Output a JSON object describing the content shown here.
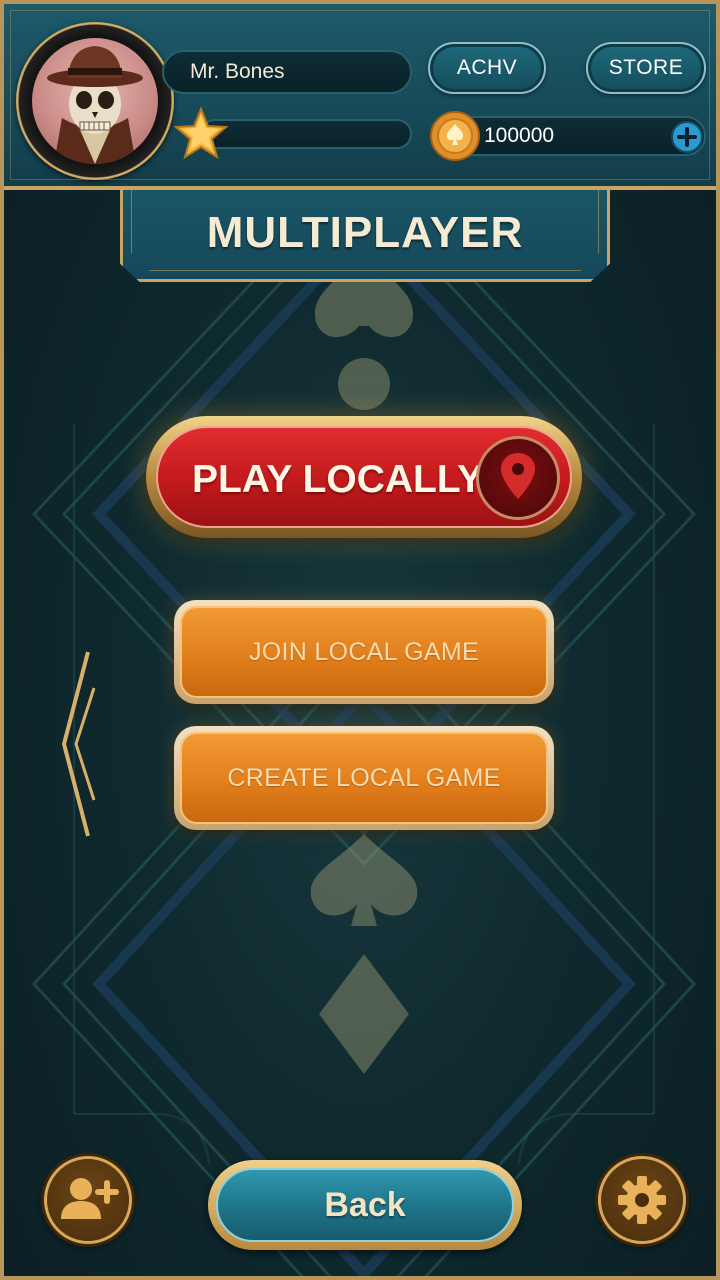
{
  "profile": {
    "player_name": "Mr. Bones",
    "coins": "100000"
  },
  "header": {
    "achievements_label": "ACHV",
    "store_label": "STORE"
  },
  "screen": {
    "title": "MULTIPLAYER"
  },
  "menu": {
    "play_locally_label": "PLAY LOCALLY",
    "join_local_game_label": "JOIN LOCAL GAME",
    "create_local_game_label": "CREATE LOCAL GAME"
  },
  "footer": {
    "back_label": "Back"
  },
  "icons": {
    "avatar": "skull-with-fedora-avatar",
    "level": "star-icon",
    "currency": "spade-coin-icon",
    "add_coins": "plus-icon",
    "play_locally": "location-pin-icon",
    "previous": "chevron-left-icon",
    "add_friend": "add-friend-icon",
    "settings": "gear-icon"
  },
  "colors": {
    "accent_gold": "#c9a565",
    "header_teal": "#1d5a6a",
    "play_red": "#c21a1d",
    "menu_orange": "#e27f1c",
    "back_teal": "#1e7388"
  }
}
